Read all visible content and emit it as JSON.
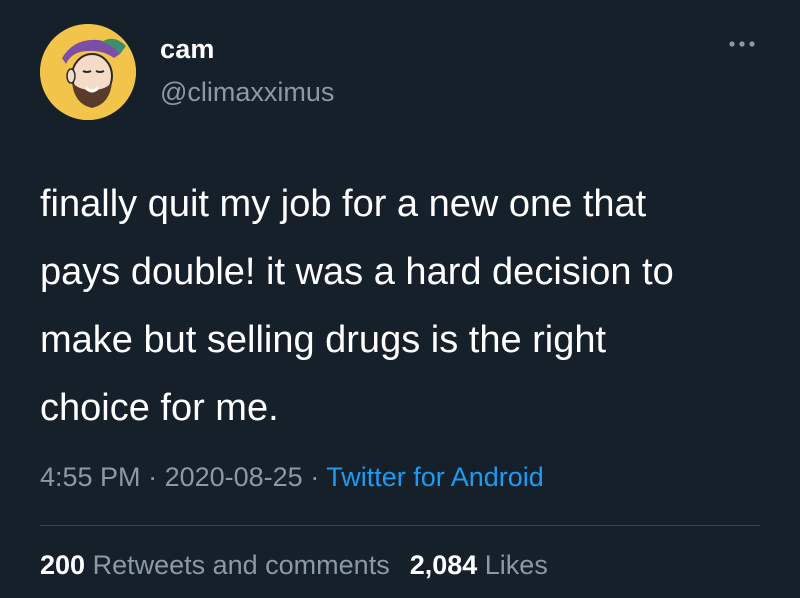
{
  "user": {
    "display_name": "cam",
    "handle": "@climaxximus",
    "avatar_icon": "profile-avatar"
  },
  "more_icon": "more-horizontal-icon",
  "tweet": {
    "text": "finally quit my job for a new one that\npays double! it was a hard decision to\nmake but selling drugs is the right\nchoice for me."
  },
  "meta": {
    "time": "4:55 PM",
    "sep1": " · ",
    "date": "2020-08-25",
    "sep2": " · ",
    "source": "Twitter for Android"
  },
  "stats": {
    "retweets_count": "200",
    "retweets_label": " Retweets and comments",
    "likes_count": "2,084",
    "likes_label": " Likes"
  },
  "colors": {
    "background": "#15202b",
    "link": "#1d9bf0",
    "secondary_text": "#8b98a5"
  }
}
